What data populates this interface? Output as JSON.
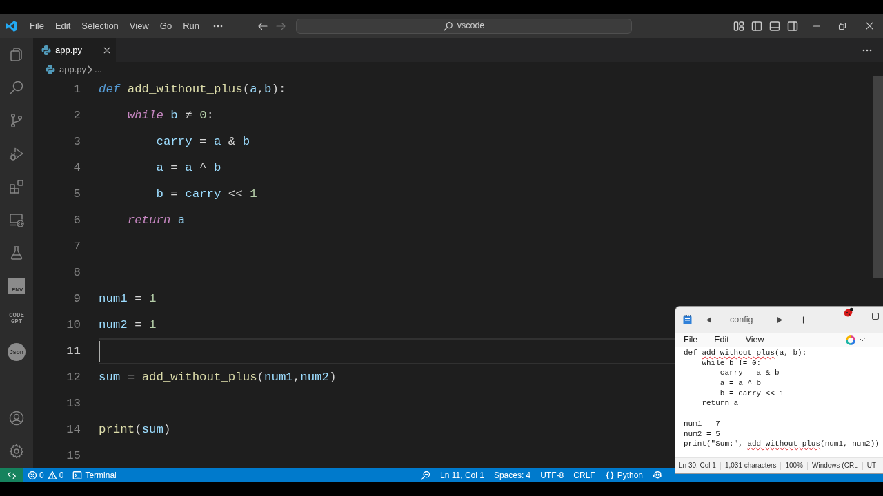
{
  "title_bar": {
    "menu": [
      {
        "label": "File"
      },
      {
        "label": "Edit"
      },
      {
        "label": "Selection"
      },
      {
        "label": "View"
      },
      {
        "label": "Go"
      },
      {
        "label": "Run"
      }
    ],
    "navigation": [
      {
        "disabled": false
      },
      {
        "disabled": true
      }
    ],
    "command_center": {
      "label": "vscode"
    }
  },
  "activity_bar": {
    "top": [
      {
        "kind": "glyph",
        "selected": false
      },
      {
        "kind": "glyph",
        "selected": false
      },
      {
        "kind": "glyph",
        "selected": false
      },
      {
        "kind": "glyph",
        "selected": false
      },
      {
        "kind": "glyph",
        "selected": false
      },
      {
        "kind": "glyph",
        "selected": false
      },
      {
        "kind": "glyph",
        "selected": false
      },
      {
        "kind": "tile",
        "label": ".ENV",
        "selected": false
      },
      {
        "kind": "wordmark",
        "label": "CODE GPT",
        "selected": false
      },
      {
        "kind": "badge",
        "label": "Json",
        "selected": false
      }
    ],
    "bottom": [
      {
        "kind": "glyph",
        "selected": false
      },
      {
        "kind": "glyph",
        "selected": false
      }
    ]
  },
  "tabs": [
    {
      "label": "app.py",
      "selected": true
    }
  ],
  "breadcrumb": {
    "file": "app.py",
    "more": "..."
  },
  "editor": {
    "lines": [
      {
        "number": "1",
        "current": false,
        "tokens": [
          {
            "kind": "keyword",
            "text": "def"
          },
          {
            "kind": "function",
            "text": " add_without_plus"
          },
          {
            "kind": "punctuation",
            "text": "("
          },
          {
            "kind": "variable",
            "text": "a"
          },
          {
            "kind": "punctuation",
            "text": ","
          },
          {
            "kind": "variable",
            "text": "b"
          },
          {
            "kind": "punctuation",
            "text": "):"
          }
        ]
      },
      {
        "number": "2",
        "current": false,
        "tokens": [
          {
            "kind": "control",
            "text": "    while"
          },
          {
            "kind": "variable",
            "text": " b"
          },
          {
            "kind": "operator",
            "text": " ≠ "
          },
          {
            "kind": "number",
            "text": "0"
          },
          {
            "kind": "punctuation",
            "text": ":"
          }
        ]
      },
      {
        "number": "3",
        "current": false,
        "tokens": [
          {
            "kind": "variable",
            "text": "        carry"
          },
          {
            "kind": "operator",
            "text": " = "
          },
          {
            "kind": "variable",
            "text": "a"
          },
          {
            "kind": "operator",
            "text": " & "
          },
          {
            "kind": "variable",
            "text": "b"
          }
        ]
      },
      {
        "number": "4",
        "current": false,
        "tokens": [
          {
            "kind": "variable",
            "text": "        a"
          },
          {
            "kind": "operator",
            "text": " = "
          },
          {
            "kind": "variable",
            "text": "a"
          },
          {
            "kind": "operator",
            "text": " ^ "
          },
          {
            "kind": "variable",
            "text": "b"
          }
        ]
      },
      {
        "number": "5",
        "current": false,
        "tokens": [
          {
            "kind": "variable",
            "text": "        b"
          },
          {
            "kind": "operator",
            "text": " = "
          },
          {
            "kind": "variable",
            "text": "carry"
          },
          {
            "kind": "operator",
            "text": " << "
          },
          {
            "kind": "number",
            "text": "1"
          }
        ]
      },
      {
        "number": "6",
        "current": false,
        "tokens": [
          {
            "kind": "control",
            "text": "    return"
          },
          {
            "kind": "variable",
            "text": " a"
          }
        ]
      },
      {
        "number": "7",
        "current": false
      },
      {
        "number": "8",
        "current": false
      },
      {
        "number": "9",
        "current": false,
        "tokens": [
          {
            "kind": "variable",
            "text": "num1"
          },
          {
            "kind": "operator",
            "text": " = "
          },
          {
            "kind": "number",
            "text": "1"
          }
        ]
      },
      {
        "number": "10",
        "current": false,
        "tokens": [
          {
            "kind": "variable",
            "text": "num2"
          },
          {
            "kind": "operator",
            "text": " = "
          },
          {
            "kind": "number",
            "text": "1"
          }
        ]
      },
      {
        "number": "11",
        "current": true
      },
      {
        "number": "12",
        "current": false,
        "tokens": [
          {
            "kind": "variable",
            "text": "sum"
          },
          {
            "kind": "operator",
            "text": " = "
          },
          {
            "kind": "function",
            "text": "add_without_plus"
          },
          {
            "kind": "punctuation",
            "text": "("
          },
          {
            "kind": "variable",
            "text": "num1"
          },
          {
            "kind": "punctuation",
            "text": ","
          },
          {
            "kind": "variable",
            "text": "num2"
          },
          {
            "kind": "punctuation",
            "text": ")"
          }
        ]
      },
      {
        "number": "13",
        "current": false
      },
      {
        "number": "14",
        "current": false,
        "tokens": [
          {
            "kind": "function",
            "text": "print"
          },
          {
            "kind": "punctuation",
            "text": "("
          },
          {
            "kind": "variable",
            "text": "sum"
          },
          {
            "kind": "punctuation",
            "text": ")"
          }
        ]
      },
      {
        "number": "15",
        "current": false
      }
    ]
  },
  "status_bar": {
    "problems": {
      "errors": "0",
      "warnings": "0"
    },
    "terminal": "Terminal",
    "items": [
      {
        "kind": "text",
        "label": "Ln 11, Col 1"
      },
      {
        "kind": "text",
        "label": "Spaces: 4"
      },
      {
        "kind": "text",
        "label": "UTF-8"
      },
      {
        "kind": "text",
        "label": "CRLF"
      },
      {
        "kind": "language",
        "label": "Python"
      }
    ]
  },
  "notepad": {
    "tab": {
      "label": "config"
    },
    "menu": [
      {
        "label": "File"
      },
      {
        "label": "Edit"
      },
      {
        "label": "View"
      }
    ],
    "text_blocks": [
      [
        [
          {
            "text": "def ",
            "misspelled": false
          },
          {
            "text": "add_without_plus",
            "misspelled": true
          },
          {
            "text": "(a, b):",
            "misspelled": false
          }
        ],
        [
          {
            "text": "    while b != 0:",
            "misspelled": false
          }
        ],
        [
          {
            "text": "        carry = a & b",
            "misspelled": false
          }
        ],
        [
          {
            "text": "        a = a ^ b",
            "misspelled": false
          }
        ],
        [
          {
            "text": "        b = carry << 1",
            "misspelled": false
          }
        ],
        [
          {
            "text": "    return a",
            "misspelled": false
          }
        ]
      ],
      [
        [
          {
            "text": "num1 = 7",
            "misspelled": false
          }
        ],
        [
          {
            "text": "num2 = 5",
            "misspelled": false
          }
        ],
        [
          {
            "text": "print(\"Sum:\", ",
            "misspelled": false
          },
          {
            "text": "add_without_plus",
            "misspelled": true
          },
          {
            "text": "(num1, num2))",
            "misspelled": false
          }
        ]
      ]
    ],
    "status": [
      {
        "label": "Ln 30, Col 1"
      },
      {
        "label": "1,031 characters"
      },
      {
        "label": "100%"
      },
      {
        "label": "Windows (CRL"
      },
      {
        "label": "UT"
      }
    ]
  }
}
